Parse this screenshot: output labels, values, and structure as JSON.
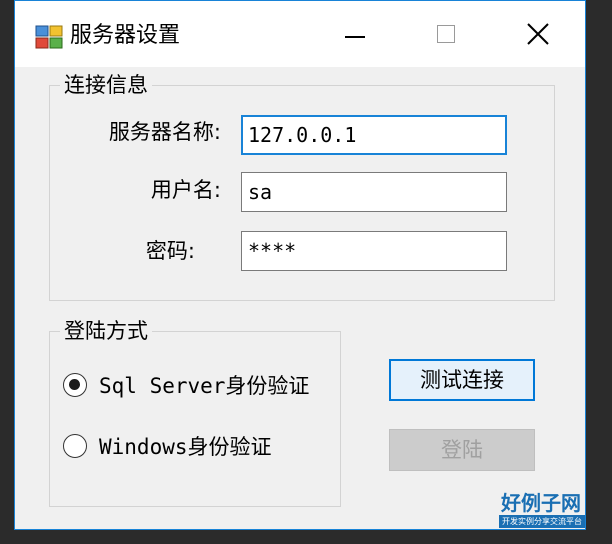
{
  "window": {
    "title": "服务器设置",
    "accent_color": "#1883d7"
  },
  "connection_group": {
    "legend": "连接信息",
    "server_label": "服务器名称:",
    "server_value": "127.0.0.1",
    "user_label": "用户名:",
    "user_value": "sa",
    "password_label": "密码:",
    "password_value": "****"
  },
  "login_group": {
    "legend": "登陆方式",
    "options": [
      {
        "label": "Sql Server身份验证",
        "checked": true
      },
      {
        "label": "Windows身份验证",
        "checked": false
      }
    ]
  },
  "buttons": {
    "test_label": "测试连接",
    "login_label": "登陆",
    "login_enabled": false
  },
  "watermark": {
    "title": "好例子网",
    "subtitle": "开发实例分享交流平台"
  }
}
